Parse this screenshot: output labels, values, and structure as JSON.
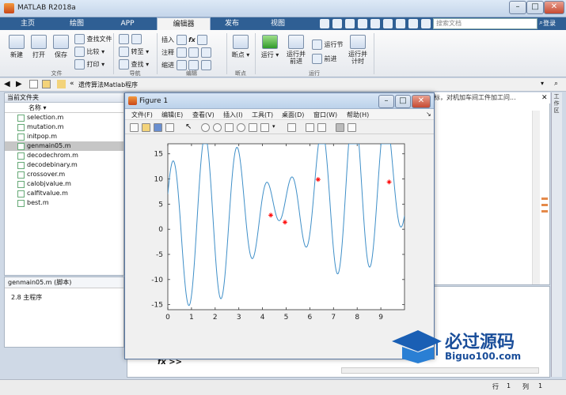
{
  "window": {
    "title": "MATLAB R2018a"
  },
  "tabs": [
    "主页",
    "绘图",
    "APP",
    "编辑器",
    "发布",
    "视图"
  ],
  "active_tab": "编辑器",
  "search_placeholder": "搜索文档",
  "collapse_label": "登录",
  "ribbon": {
    "file": {
      "new": "新建",
      "open": "打开",
      "save": "保存",
      "find_files": "查找文件",
      "compare": "比较",
      "print": "打印",
      "group": "文件"
    },
    "nav": {
      "goto": "转至",
      "find": "查找",
      "group": "导航"
    },
    "edit": {
      "insert": "插入",
      "comment": "注释",
      "indent": "缩进",
      "group": "编辑"
    },
    "breakpoints": {
      "label": "断点",
      "group": "断点"
    },
    "run": {
      "run": "运行",
      "run_advance": "运行并\n前进",
      "run_section": "运行节",
      "advance": "前进",
      "run_time": "运行并\n计时",
      "group": "运行"
    }
  },
  "address": {
    "path": "遗传算法Matlab程序"
  },
  "file_panel": {
    "title": "当前文件夹",
    "column": "名称",
    "files": [
      "selection.m",
      "mutation.m",
      "initpop.m",
      "genmain05.m",
      "decodechrom.m",
      "decodebinary.m",
      "crossover.m",
      "calobjvalue.m",
      "calfitvalue.m",
      "best.m"
    ],
    "selected": "genmain05.m"
  },
  "detail_panel": {
    "header": "genmain05.m  (脚本)",
    "body": "2.8 主程序"
  },
  "editor_snippet": "标，对机加车间工件加工问...",
  "workspace_tab": "工作区",
  "figure": {
    "title": "Figure 1",
    "menu": [
      "文件(F)",
      "编辑(E)",
      "查看(V)",
      "插入(I)",
      "工具(T)",
      "桌面(D)",
      "窗口(W)",
      "帮助(H)"
    ]
  },
  "command_prompt": "fx >>",
  "status": {
    "row_label": "行",
    "row": "1",
    "col_label": "列",
    "col": "1"
  },
  "logo": {
    "zh": "必过源码",
    "en": "Biguo100.com"
  },
  "chart_data": {
    "type": "line",
    "xlim": [
      0,
      10
    ],
    "ylim": [
      -16,
      17
    ],
    "xticks": [
      0,
      1,
      2,
      3,
      4,
      5,
      6,
      7,
      8,
      9
    ],
    "yticks": [
      15,
      10,
      5,
      0,
      -5,
      -10,
      -15
    ],
    "function": "x + 10*sin(5*x) + 7*cos(4*x)",
    "line_color": "#3f8fc8",
    "marker_color": "#ff0000",
    "markers": [
      {
        "x": 4.35,
        "y": 2.8
      },
      {
        "x": 4.95,
        "y": 1.4
      },
      {
        "x": 6.35,
        "y": 9.9
      },
      {
        "x": 9.35,
        "y": 9.4
      }
    ]
  }
}
